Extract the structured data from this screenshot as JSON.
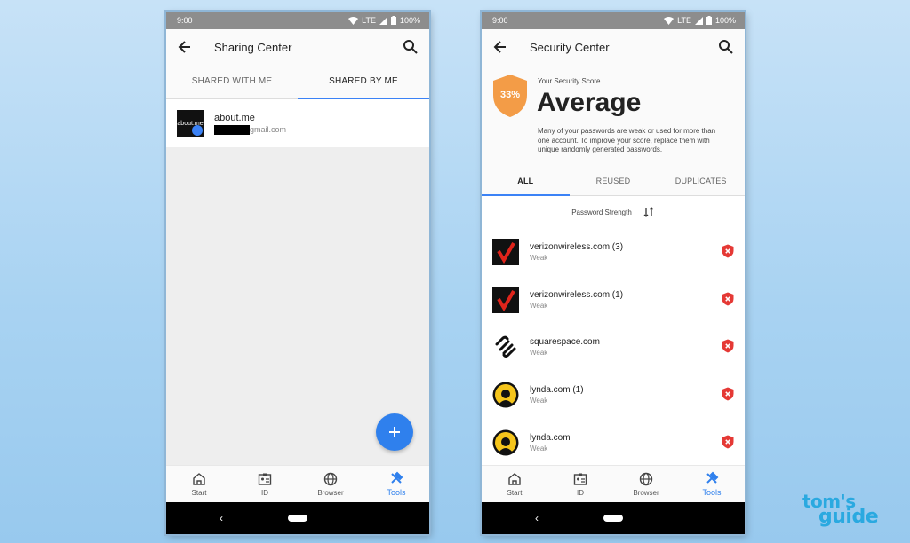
{
  "status": {
    "time": "9:00",
    "network": "LTE",
    "battery": "100%"
  },
  "left": {
    "title": "Sharing Center",
    "tabs": [
      {
        "label": "SHARED WITH ME"
      },
      {
        "label": "SHARED BY ME"
      }
    ],
    "active_tab": 1,
    "shared_items": [
      {
        "name": "about.me",
        "thumb_text": "about.me",
        "email_suffix": "gmail.com"
      }
    ],
    "fab_icon": "plus-icon"
  },
  "right": {
    "title": "Security Center",
    "score_percent": "33%",
    "score_label": "Your Security Score",
    "score_value": "Average",
    "score_description": "Many of your passwords are weak or used for more than one account. To improve your score, replace them with unique randomly generated passwords.",
    "tabs": [
      {
        "label": "ALL"
      },
      {
        "label": "REUSED"
      },
      {
        "label": "DUPLICATES"
      }
    ],
    "active_tab": 0,
    "sort_label": "Password Strength",
    "passwords": [
      {
        "name": "verizonwireless.com (3)",
        "strength": "Weak",
        "icon": "verizon-icon"
      },
      {
        "name": "verizonwireless.com (1)",
        "strength": "Weak",
        "icon": "verizon-icon"
      },
      {
        "name": "squarespace.com",
        "strength": "Weak",
        "icon": "squarespace-icon"
      },
      {
        "name": "lynda.com (1)",
        "strength": "Weak",
        "icon": "lynda-icon"
      },
      {
        "name": "lynda.com",
        "strength": "Weak",
        "icon": "lynda-icon"
      }
    ]
  },
  "nav": [
    {
      "label": "Start",
      "icon": "home-icon"
    },
    {
      "label": "ID",
      "icon": "id-card-icon"
    },
    {
      "label": "Browser",
      "icon": "globe-icon"
    },
    {
      "label": "Tools",
      "icon": "tools-icon"
    }
  ],
  "nav_active": 3,
  "colors": {
    "accent": "#2f80ed",
    "score": "#f39c47",
    "warning": "#e53935"
  },
  "watermark": {
    "line1": "tom's",
    "line2": "guide"
  }
}
